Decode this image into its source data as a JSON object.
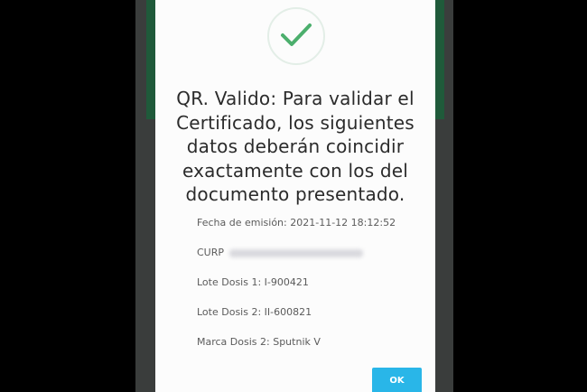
{
  "dialog": {
    "status_icon": "check-icon",
    "headline": "QR. Valido: Para validar el Certificado, los siguientes datos deberán coincidir exactamente con los del documento presentado.",
    "fields": [
      {
        "label": "Fecha de emisión:",
        "value": "2021-11-12 18:12:52"
      },
      {
        "label": "CURP",
        "value": ""
      },
      {
        "label": "Lote Dosis 1:",
        "value": "I-900421"
      },
      {
        "label": "Lote Dosis 2:",
        "value": "II-600821"
      },
      {
        "label": "Marca Dosis 2:",
        "value": "Sputnik V"
      }
    ],
    "ok_label": "OK"
  },
  "colors": {
    "check_green": "#4caf6d",
    "ok_button": "#29b6e8",
    "app_bar_green": "#1f5a3a"
  }
}
